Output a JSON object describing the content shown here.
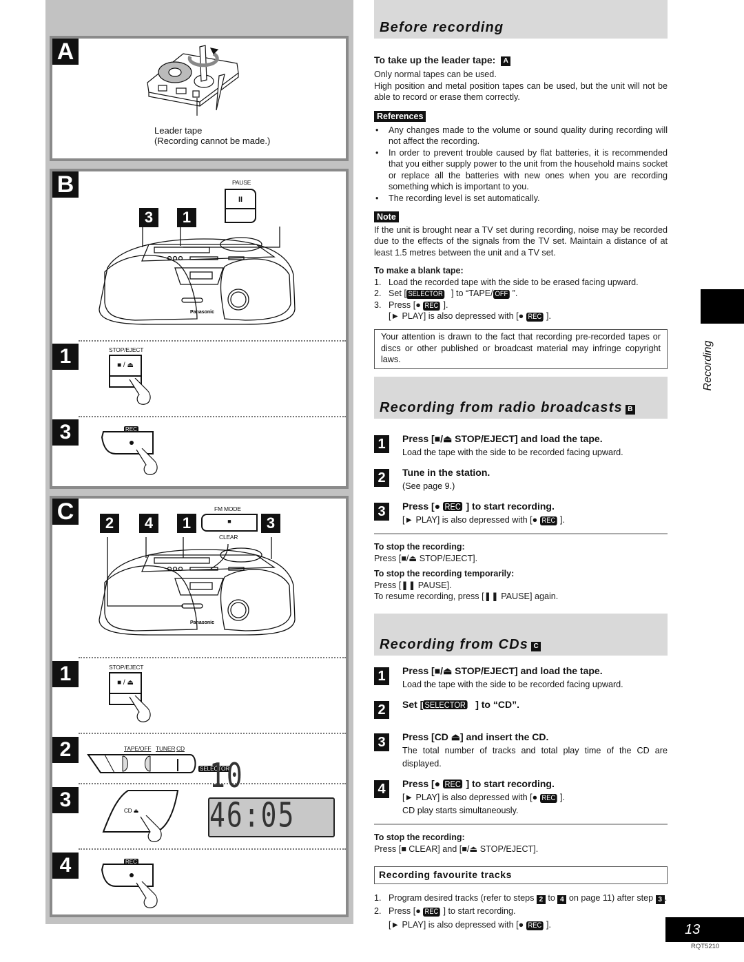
{
  "left_panels": {
    "A": {
      "letter": "A",
      "caption_line1": "Leader tape",
      "caption_line2": "(Recording cannot be made.)"
    },
    "B": {
      "letter": "B",
      "callouts": [
        "3",
        "1"
      ],
      "pause_label": "PAUSE",
      "pause_symbol": "II",
      "brand": "Panasonic",
      "steps": [
        {
          "num": "1",
          "button_label": "STOP/EJECT",
          "button_symbol": "■ / ⏏"
        },
        {
          "num": "3",
          "button_label": "REC",
          "button_symbol": "●"
        }
      ]
    },
    "C": {
      "letter": "C",
      "callouts": [
        "2",
        "4",
        "1",
        "3"
      ],
      "fm_mode_label": "FM MODE",
      "clear_label": "CLEAR",
      "clear_symbol": "■",
      "brand": "Panasonic",
      "steps": [
        {
          "num": "1",
          "button_label": "STOP/EJECT",
          "button_symbol": "■ / ⏏"
        },
        {
          "num": "2",
          "selector_positions": [
            "TAPE/OFF",
            "TUNER",
            "CD"
          ],
          "selector_label": "SELECTOR"
        },
        {
          "num": "3",
          "button_label": "CD ⏏",
          "display": "10  46:05"
        },
        {
          "num": "4",
          "button_label": "REC",
          "button_symbol": "●"
        }
      ]
    }
  },
  "before_recording": {
    "title": "Before recording",
    "leader_heading": "To take up the leader tape:",
    "leader_ref": "A",
    "leader_p1": "Only normal tapes can be used.",
    "leader_p2": "High position and metal position tapes can be used, but the unit will not be able to record or erase them correctly.",
    "references_label": "References",
    "references": [
      "Any changes made to the volume or sound quality during recording will not affect the recording.",
      "In order to prevent trouble caused by flat batteries, it is recommended that you either supply power to the unit from the household mains socket or replace all the batteries with new ones when you are recording something which is important to you.",
      "The recording level is set automatically."
    ],
    "note_label": "Note",
    "note_text": "If the unit is brought near a TV set during recording, noise may be recorded due to the effects of the signals from the TV set. Maintain a distance of at least 1.5 metres between the unit and a TV set.",
    "blank_heading": "To make a blank tape:",
    "blank_steps": [
      {
        "n": "1.",
        "text": "Load the recorded tape with the side to be erased facing upward."
      },
      {
        "n": "2.",
        "pre": "Set [",
        "chip": "SELECTOR",
        "mid": "] to “TAPE/",
        "chip2": "OFF",
        "post": "”."
      },
      {
        "n": "3.",
        "pre": "Press [● ",
        "chip": "REC",
        "post": "].",
        "line2_pre": "[► PLAY] is also depressed with [● ",
        "line2_chip": "REC",
        "line2_post": "]."
      }
    ],
    "copyright_notice": "Your attention is drawn to the fact that recording pre-recorded tapes or discs or other published or broadcast material may infringe copyright laws."
  },
  "radio": {
    "title": "Recording from radio broadcasts",
    "ref": "B",
    "steps": [
      {
        "num": "1",
        "title": "Press [■/⏏ STOP/EJECT] and load the tape.",
        "desc": "Load the tape with the side to be recorded facing upward."
      },
      {
        "num": "2",
        "title": "Tune in the station.",
        "desc": "(See page 9.)"
      },
      {
        "num": "3",
        "title_pre": "Press [● ",
        "title_chip": "REC",
        "title_post": "] to start recording.",
        "desc_pre": "[► PLAY] is also depressed with [● ",
        "desc_chip": "REC",
        "desc_post": "]."
      }
    ],
    "stop_heading": "To stop the recording:",
    "stop_text": "Press [■/⏏ STOP/EJECT].",
    "pause_heading": "To stop the recording temporarily:",
    "pause_text": "Press [❚❚ PAUSE].",
    "resume_text": "To resume recording, press [❚❚ PAUSE] again."
  },
  "cds": {
    "title": "Recording from CDs",
    "ref": "C",
    "steps": [
      {
        "num": "1",
        "title": "Press [■/⏏ STOP/EJECT] and load the tape.",
        "desc": "Load the tape with the side to be recorded facing upward."
      },
      {
        "num": "2",
        "title_pre": "Set [",
        "title_chip": "SELECTOR",
        "title_post": "] to “CD”."
      },
      {
        "num": "3",
        "title": "Press [CD ⏏] and insert the CD.",
        "desc": "The total number of tracks and total play time of the CD are displayed."
      },
      {
        "num": "4",
        "title_pre": "Press [● ",
        "title_chip": "REC",
        "title_post": "] to start recording.",
        "desc_pre": "[► PLAY] is also depressed with [● ",
        "desc_chip": "REC",
        "desc_post": "].",
        "desc2": "CD play starts simultaneously."
      }
    ],
    "stop_heading": "To stop the recording:",
    "stop_text": "Press [■ CLEAR] and [■/⏏ STOP/EJECT].",
    "fav_title": "Recording favourite tracks",
    "fav_steps": {
      "s1_pre": "Program desired tracks (refer to steps ",
      "s1_c1": "2",
      "s1_mid": " to ",
      "s1_c2": "4",
      "s1_post": " on page 11) after step ",
      "s1_c3": "3",
      "s1_end": ".",
      "s2_pre": "Press [● ",
      "s2_chip": "REC",
      "s2_post": "] to start recording.",
      "s2_l2_pre": "[► PLAY] is also depressed with [● ",
      "s2_l2_chip": "REC",
      "s2_l2_post": "]."
    }
  },
  "side_tab": {
    "label": "Recording"
  },
  "footer": {
    "page_number": "13",
    "model_code": "RQT5210"
  }
}
